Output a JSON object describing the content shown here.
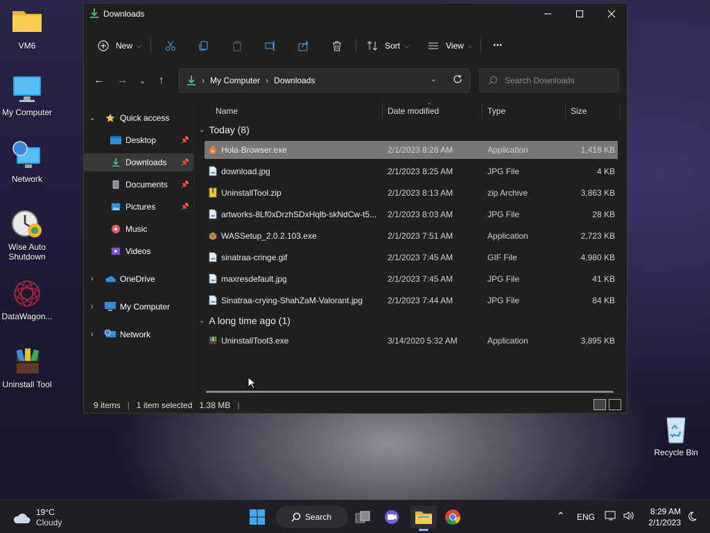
{
  "desktop": {
    "icons": [
      {
        "label": "VM6"
      },
      {
        "label": "My Computer"
      },
      {
        "label": "Network"
      },
      {
        "label": "Wise Auto\nShutdown"
      },
      {
        "label": "DataWagon..."
      },
      {
        "label": "Uninstall Tool"
      },
      {
        "label": "Recycle Bin"
      }
    ]
  },
  "window": {
    "title": "Downloads",
    "toolbar": {
      "new_label": "New",
      "sort_label": "Sort",
      "view_label": "View",
      "more_label": "..."
    },
    "address": {
      "root": "My Computer",
      "current": "Downloads"
    },
    "search": {
      "placeholder": "Search Downloads"
    },
    "nav": {
      "quick_access": "Quick access",
      "items": [
        {
          "label": "Desktop"
        },
        {
          "label": "Downloads"
        },
        {
          "label": "Documents"
        },
        {
          "label": "Pictures"
        },
        {
          "label": "Music"
        },
        {
          "label": "Videos"
        }
      ],
      "onedrive": "OneDrive",
      "my_computer": "My Computer",
      "network": "Network"
    },
    "columns": {
      "name": "Name",
      "date": "Date modified",
      "type": "Type",
      "size": "Size"
    },
    "groups": {
      "today": "Today (8)",
      "long_ago": "A long time ago (1)"
    },
    "files_today": [
      {
        "name": "Hola-Browser.exe",
        "date": "2/1/2023 8:28 AM",
        "type": "Application",
        "size": "1,418 KB"
      },
      {
        "name": "download.jpg",
        "date": "2/1/2023 8:25 AM",
        "type": "JPG File",
        "size": "4 KB"
      },
      {
        "name": "UninstallTool.zip",
        "date": "2/1/2023 8:13 AM",
        "type": "zip Archive",
        "size": "3,863 KB"
      },
      {
        "name": "artworks-8Lf0xDrzhSDxHqlb-skNdCw-t5...",
        "date": "2/1/2023 8:03 AM",
        "type": "JPG File",
        "size": "28 KB"
      },
      {
        "name": "WASSetup_2.0.2.103.exe",
        "date": "2/1/2023 7:51 AM",
        "type": "Application",
        "size": "2,723 KB"
      },
      {
        "name": "sinatraa-cringe.gif",
        "date": "2/1/2023 7:45 AM",
        "type": "GIF File",
        "size": "4,980 KB"
      },
      {
        "name": "maxresdefault.jpg",
        "date": "2/1/2023 7:45 AM",
        "type": "JPG File",
        "size": "41 KB"
      },
      {
        "name": "Sinatraa-crying-ShahZaM-Valorant.jpg",
        "date": "2/1/2023 7:44 AM",
        "type": "JPG File",
        "size": "84 KB"
      }
    ],
    "files_old": [
      {
        "name": "UninstallTool3.exe",
        "date": "3/14/2020 5:32 AM",
        "type": "Application",
        "size": "3,895 KB"
      }
    ],
    "status": {
      "count": "9 items",
      "selected": "1 item selected",
      "size": "1.38 MB"
    }
  },
  "taskbar": {
    "weather_temp": "19°C",
    "weather_desc": "Cloudy",
    "search_label": "Search",
    "lang": "ENG",
    "time": "8:29 AM",
    "date": "2/1/2023"
  },
  "colors": {
    "accent_green": "#4cc27a",
    "folder_yellow": "#f5c542",
    "selection": "#777777"
  }
}
